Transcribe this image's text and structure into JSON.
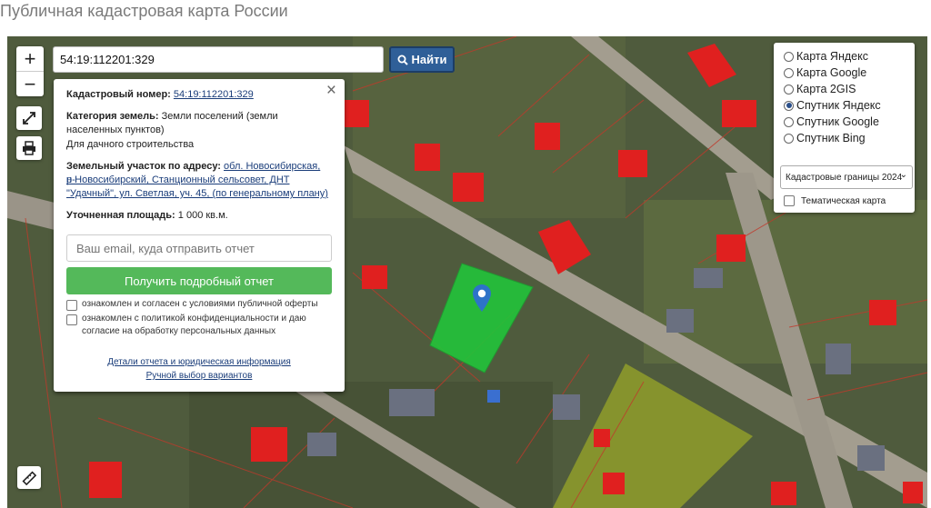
{
  "page": {
    "title": "Публичная кадастровая карта России"
  },
  "search": {
    "value": "54:19:112201:329",
    "button_label": "Найти"
  },
  "zoom": {
    "in_label": "+",
    "out_label": "−"
  },
  "info": {
    "cad_label": "Кадастровый номер:",
    "cad_value": "54:19:112201:329",
    "category_label": "Категория земель:",
    "category_value": "Земли поселений (земли населенных пунктов)",
    "usage": "Для дачного строительства",
    "address_label": "Земельный участок по адресу:",
    "address_line1": "обл. Новосибирская, р-",
    "address_line2": "н Новосибирский, Станционный сельсовет, ДНТ",
    "address_line3": "\"Удачный\", ул. Светлая, уч. 45, (по генеральному плану)",
    "area_label": "Уточненная площадь:",
    "area_value": "1 000 кв.м.",
    "email_placeholder": "Ваш email, куда отправить отчет",
    "report_button": "Получить подробный отчет",
    "check1": "ознакомлен и согласен с условиями публичной оферты",
    "check2_line1": "ознакомлен с политикой конфиденциальности и даю",
    "check2_line2": "согласие на обработку персональных данных",
    "link_details": "Детали отчета и юридическая информация",
    "link_manual": "Ручной выбор вариантов"
  },
  "layers": {
    "options": [
      {
        "label": "Карта Яндекс",
        "selected": false
      },
      {
        "label": "Карта Google",
        "selected": false
      },
      {
        "label": "Карта 2GIS",
        "selected": false
      },
      {
        "label": "Спутник Яндекс",
        "selected": true
      },
      {
        "label": "Спутник Google",
        "selected": false
      },
      {
        "label": "Спутник Bing",
        "selected": false
      }
    ],
    "select_value": "Кадастровые границы 2024",
    "thematic_label": "Тематическая карта"
  },
  "icons": {
    "fullscreen": "expand-icon",
    "print": "printer-icon",
    "ruler": "ruler-icon",
    "search": "search-icon",
    "marker": "map-marker-icon"
  },
  "colors": {
    "search_button": "#2f5f98",
    "report_button": "#54b95a",
    "parcel_highlight": "#22c43a",
    "building": "#e0201f"
  }
}
